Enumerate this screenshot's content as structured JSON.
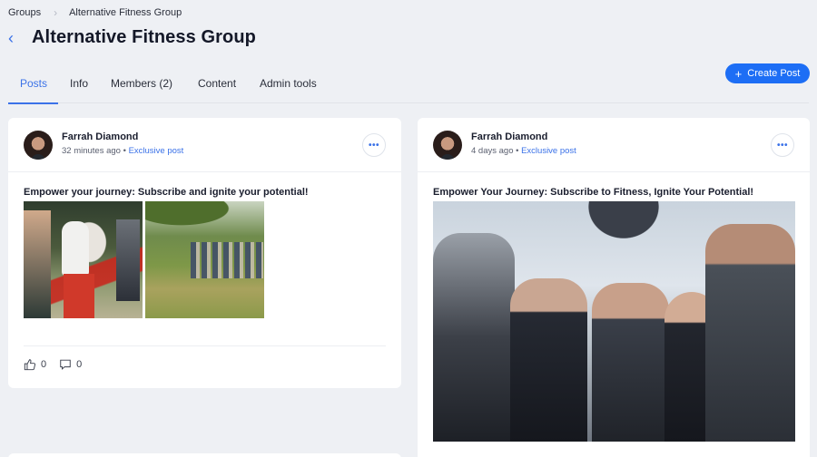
{
  "breadcrumb": {
    "items": [
      "Groups",
      "Alternative Fitness Group"
    ],
    "separator": "›"
  },
  "header": {
    "back_icon": "chevron-left-icon",
    "title": "Alternative Fitness Group"
  },
  "tabs": [
    {
      "label": "Posts",
      "active": true
    },
    {
      "label": "Info",
      "active": false
    },
    {
      "label": "Members (2)",
      "active": false
    },
    {
      "label": "Content",
      "active": false
    },
    {
      "label": "Admin tools",
      "active": false
    }
  ],
  "create_post": {
    "icon": "plus-icon",
    "label": "Create Post"
  },
  "colors": {
    "accent": "#1d6ef5",
    "link": "#3b72e8",
    "background": "#eef0f4"
  },
  "posts": [
    {
      "author": "Farrah Diamond",
      "time": "32 minutes ago",
      "bullet": "•",
      "visibility": "Exclusive post",
      "more_label": "•••",
      "text": "Empower your journey: Subscribe and ignite your potential!",
      "images": [
        "Boxing class outdoors",
        "Group squatting in park"
      ],
      "likes": "0",
      "comments": "0"
    },
    {
      "author": "Farrah Diamond",
      "time": "4 days ago",
      "bullet": "•",
      "visibility": "Exclusive post",
      "more_label": "•••",
      "text": "Empower Your Journey: Subscribe to Fitness, Ignite Your Potential!",
      "images": [
        "Group high five"
      ]
    }
  ]
}
